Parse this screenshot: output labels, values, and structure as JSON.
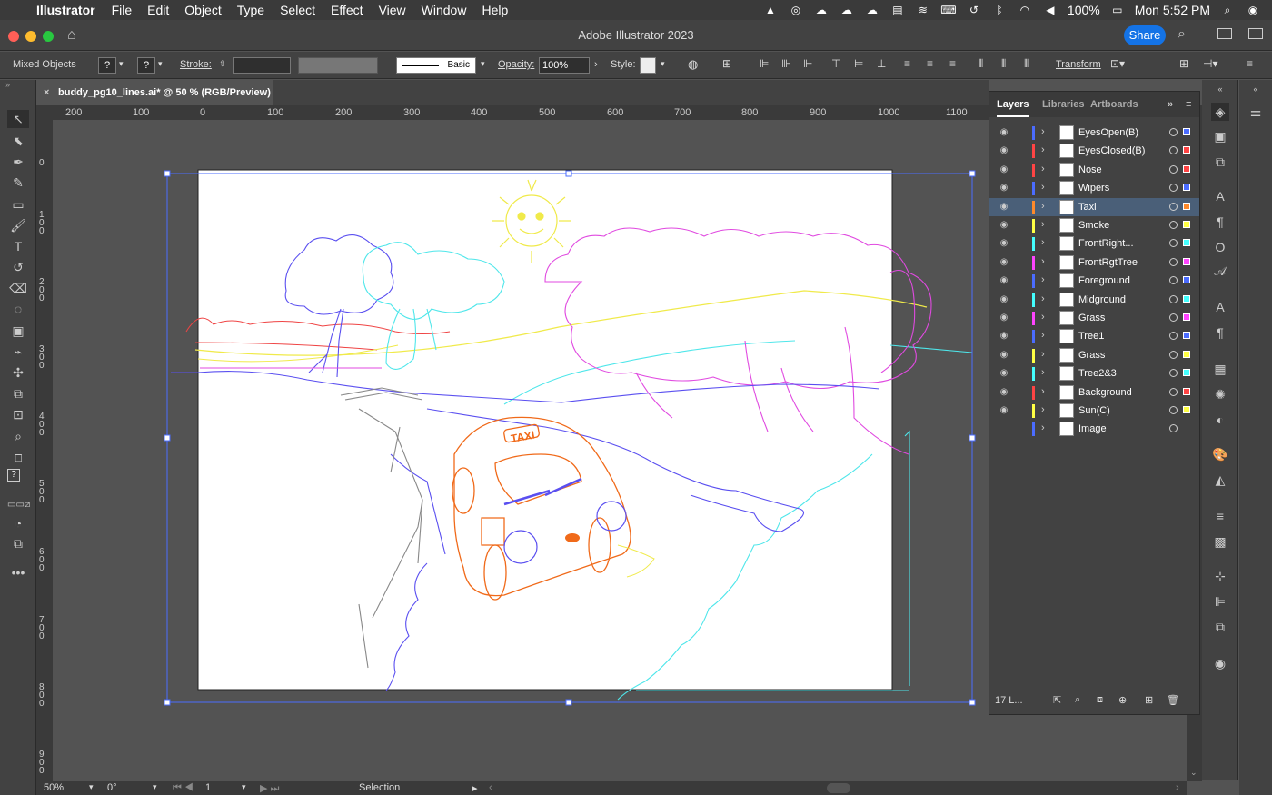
{
  "menubar": {
    "app": "Illustrator",
    "items": [
      "File",
      "Edit",
      "Object",
      "Type",
      "Select",
      "Effect",
      "View",
      "Window",
      "Help"
    ],
    "battery": "100%",
    "clock": "Mon 5:52 PM"
  },
  "window": {
    "title": "Adobe Illustrator 2023",
    "share_label": "Share"
  },
  "controlbar": {
    "selection_label": "Mixed Objects",
    "q1": "?",
    "q2": "?",
    "stroke_label": "Stroke:",
    "brush_label": "Basic",
    "opacity_label": "Opacity:",
    "opacity_value": "100%",
    "style_label": "Style:",
    "transform_label": "Transform"
  },
  "document": {
    "tab_title": "buddy_pg10_lines.ai* @ 50 % (RGB/Preview)"
  },
  "ruler_h": [
    "200",
    "100",
    "0",
    "100",
    "200",
    "300",
    "400",
    "500",
    "600",
    "700",
    "800",
    "900",
    "1000",
    "1100"
  ],
  "ruler_v": [
    "0",
    "100",
    "200",
    "300",
    "400",
    "500",
    "600",
    "700",
    "800",
    "900"
  ],
  "artwork": {
    "taxi_sign": "TAXI"
  },
  "layers_panel": {
    "tabs": [
      "Layers",
      "Libraries",
      "Artboards"
    ],
    "layers": [
      {
        "name": "EyesOpen(B)",
        "color": "#4b6cff"
      },
      {
        "name": "EyesClosed(B)",
        "color": "#ff4444"
      },
      {
        "name": "Nose",
        "color": "#ff4444"
      },
      {
        "name": "Wipers",
        "color": "#4b6cff"
      },
      {
        "name": "Taxi",
        "color": "#ff8a2b",
        "selected": true
      },
      {
        "name": "Smoke",
        "color": "#ffff44"
      },
      {
        "name": "FrontRight...",
        "color": "#44ffff"
      },
      {
        "name": "FrontRgtTree",
        "color": "#ff44ff"
      },
      {
        "name": "Foreground",
        "color": "#4b6cff"
      },
      {
        "name": "Midground",
        "color": "#44ffff"
      },
      {
        "name": "Grass",
        "color": "#ff44ff"
      },
      {
        "name": "Tree1",
        "color": "#4b6cff"
      },
      {
        "name": "Grass",
        "color": "#ffff44"
      },
      {
        "name": "Tree2&3",
        "color": "#44ffff"
      },
      {
        "name": "Background",
        "color": "#ff4444"
      },
      {
        "name": "Sun(C)",
        "color": "#ffff44"
      },
      {
        "name": "Image",
        "color": "#4b6cff"
      }
    ],
    "count_label": "17 L..."
  },
  "status": {
    "zoom": "50%",
    "rotation": "0°",
    "artboard": "1",
    "tool": "Selection"
  }
}
